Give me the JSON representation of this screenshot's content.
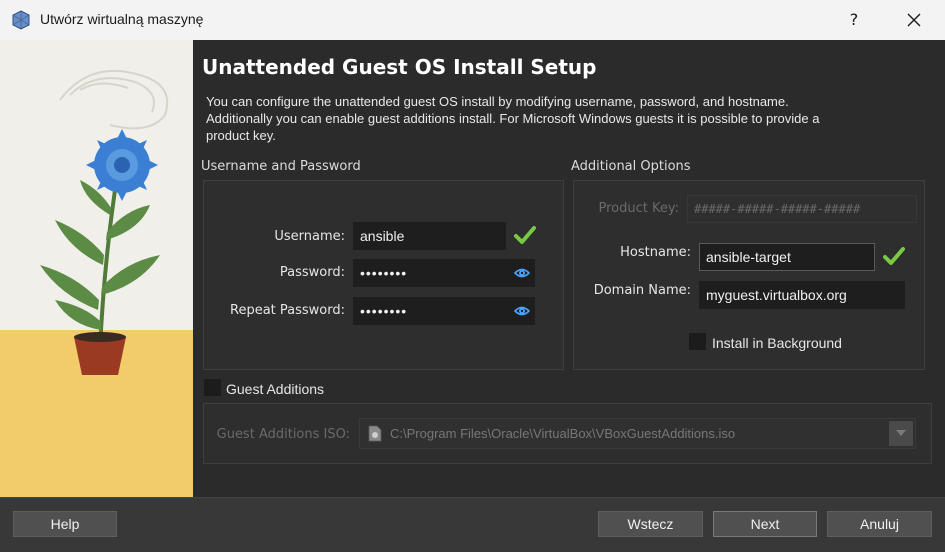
{
  "window": {
    "title": "Utwórz wirtualną maszynę",
    "help_label": "?"
  },
  "page": {
    "title": "Unattended Guest OS Install Setup",
    "intro": "You can configure the unattended guest OS install by modifying username, password, and hostname. Additionally you can enable guest additions install. For Microsoft Windows guests it is possible to provide a product key."
  },
  "username_group": {
    "title": "Username and Password",
    "username_label": "Username:",
    "username_value": "ansible",
    "password_label": "Password:",
    "password_value": "••••••••",
    "repeat_label": "Repeat Password:",
    "repeat_value": "••••••••"
  },
  "options_group": {
    "title": "Additional Options",
    "product_key_label": "Product Key:",
    "product_key_placeholder": "#####-#####-#####-#####",
    "hostname_label": "Hostname:",
    "hostname_value": "ansible-target",
    "domain_label": "Domain Name:",
    "domain_value": "myguest.virtualbox.org",
    "install_bg_label": "Install in Background"
  },
  "guest_additions": {
    "label": "Guest Additions",
    "iso_label": "Guest Additions ISO:",
    "iso_path": "C:\\Program Files\\Oracle\\VirtualBox\\VBoxGuestAdditions.iso"
  },
  "footer": {
    "help": "Help",
    "back": "Wstecz",
    "next": "Next",
    "cancel": "Anuluj"
  },
  "colors": {
    "check_green": "#7ac943",
    "eye_blue": "#4aa3ff",
    "flower_blue": "#3b7fd4",
    "floor_yellow": "#f2cc6b"
  }
}
